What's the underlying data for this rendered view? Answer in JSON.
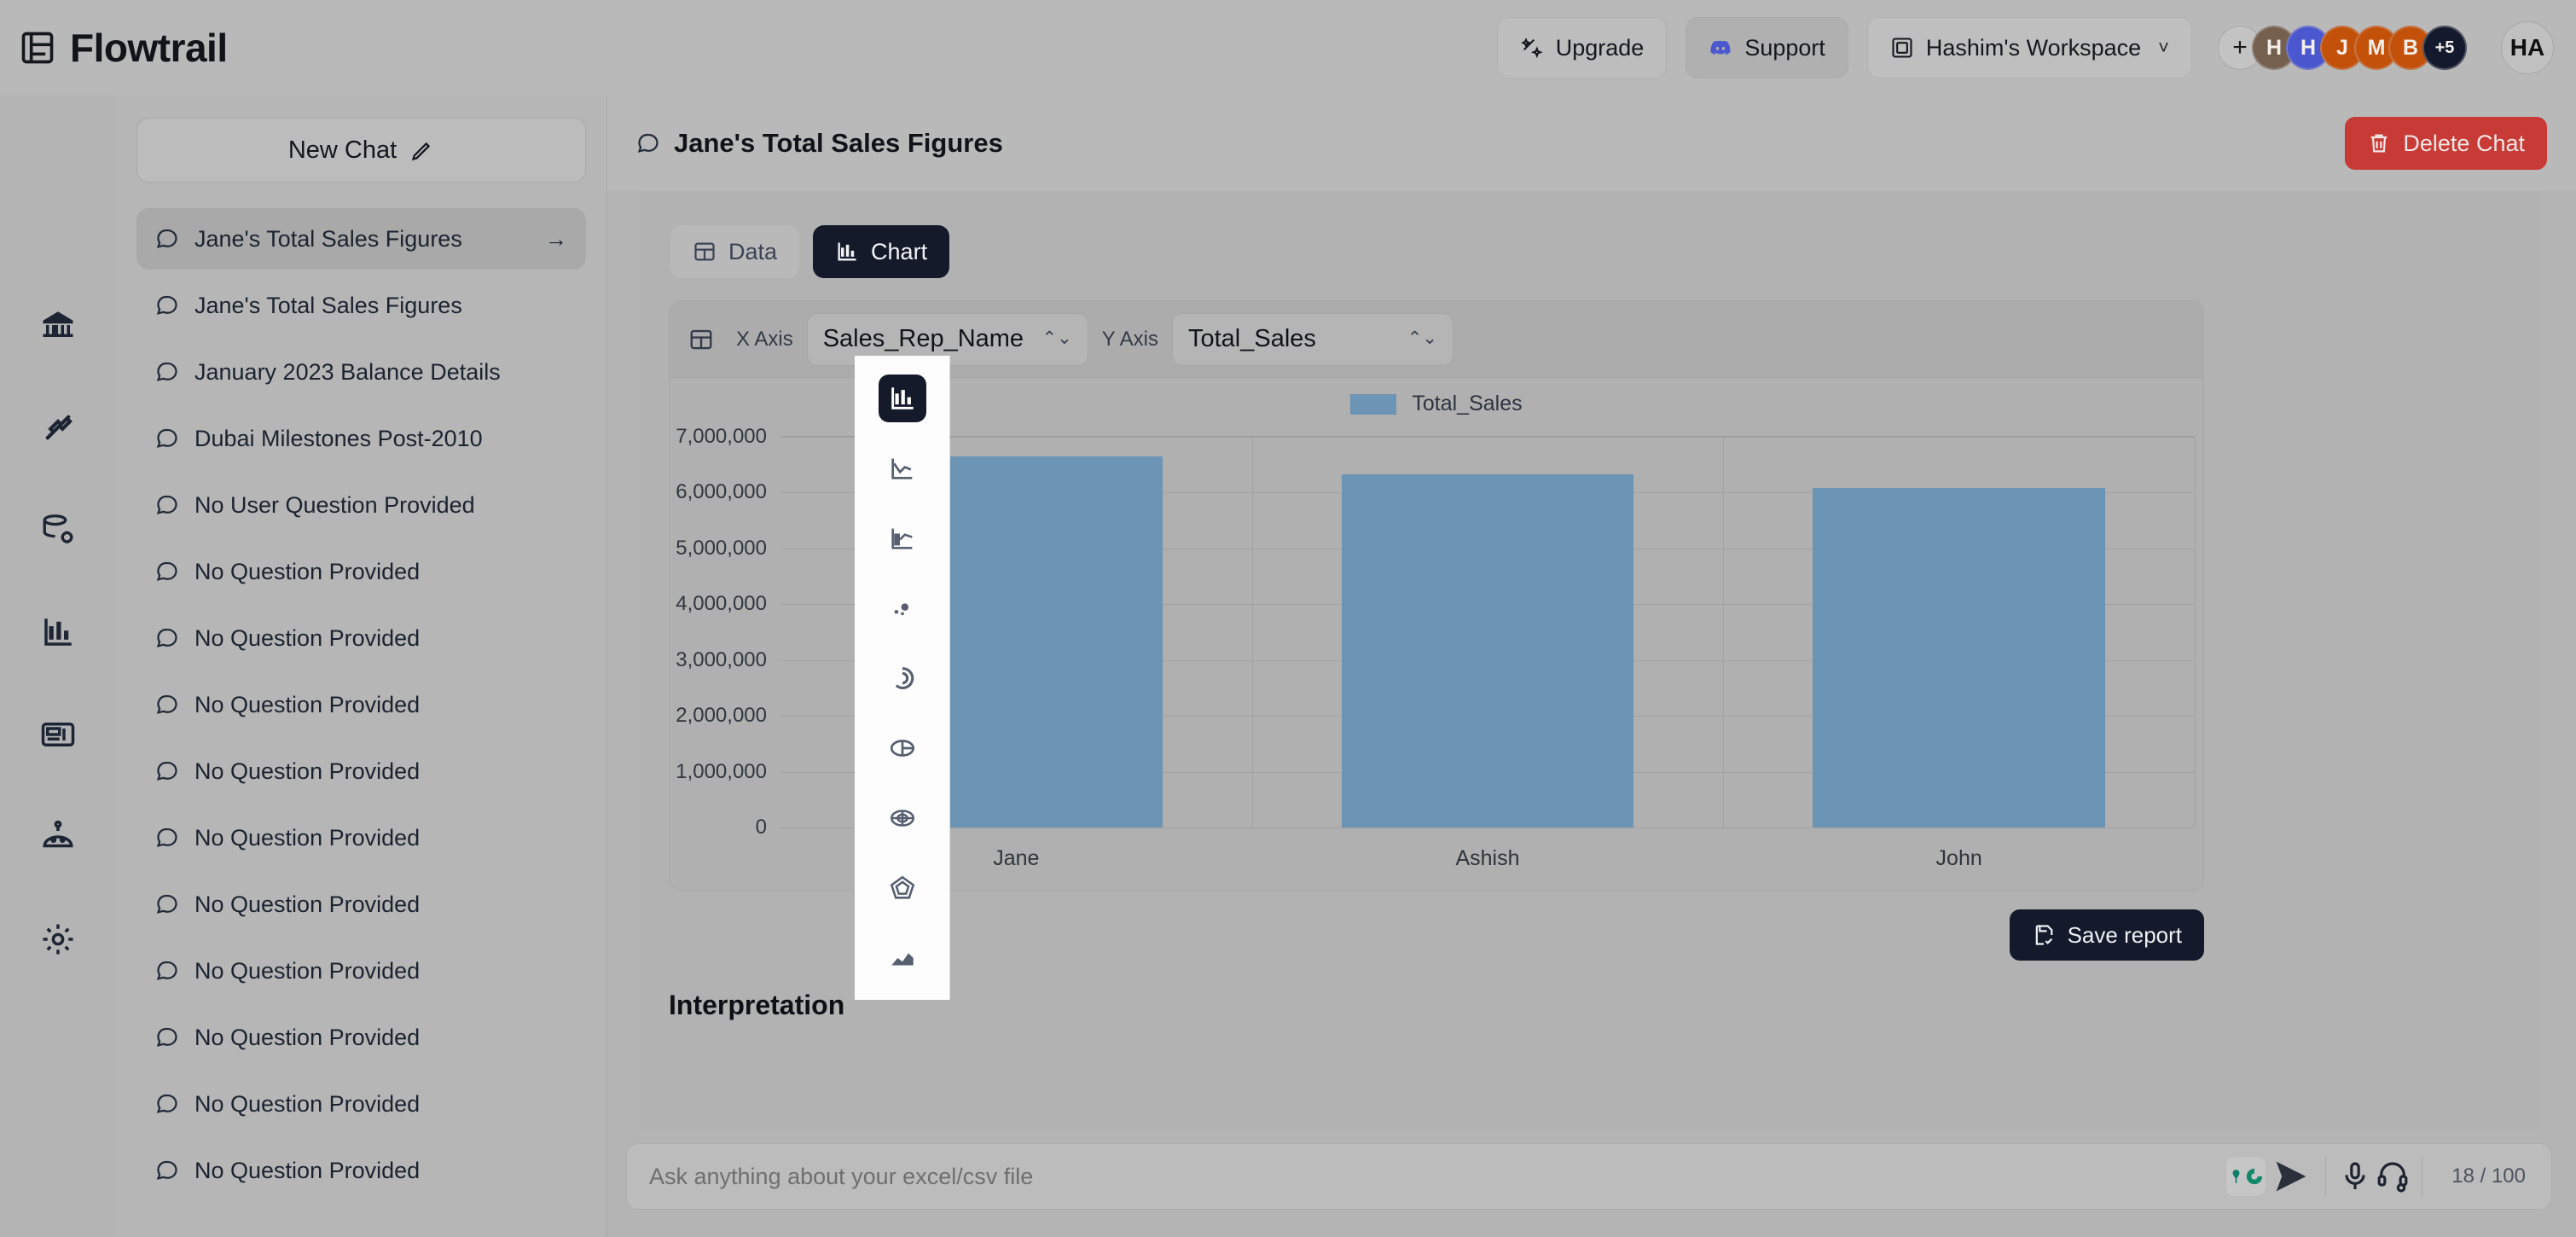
{
  "brand": {
    "name": "Flowtrail",
    "logo_icon": "grid-logo-icon"
  },
  "header": {
    "upgrade_label": "Upgrade",
    "upgrade_icon": "sparkle-icon",
    "support_label": "Support",
    "support_icon": "discord-icon",
    "workspace_label": "Hashim's Workspace",
    "workspace_icon": "workspace-icon",
    "workspace_chevron": "˅",
    "add_member_label": "+",
    "avatars": [
      {
        "initial": "H",
        "color": "#75604f"
      },
      {
        "initial": "H",
        "color": "#4a57cf"
      },
      {
        "initial": "J",
        "color": "#c4510a"
      },
      {
        "initial": "M",
        "color": "#c4510a"
      },
      {
        "initial": "B",
        "color": "#c4510a"
      },
      {
        "initial": "+5",
        "color": "#141a2e"
      }
    ],
    "self_avatar": "HA"
  },
  "rail": {
    "items": [
      {
        "name": "home",
        "icon": "bank-home-icon"
      },
      {
        "name": "connections",
        "icon": "plug-connect-icon"
      },
      {
        "name": "datasources",
        "icon": "database-settings-icon"
      },
      {
        "name": "charts",
        "icon": "bar-chart-icon"
      },
      {
        "name": "dashboards",
        "icon": "dashboard-icon"
      },
      {
        "name": "assistant",
        "icon": "robot-icon"
      },
      {
        "name": "settings",
        "icon": "gear-icon"
      }
    ]
  },
  "sidebar": {
    "new_chat_label": "New Chat",
    "new_chat_icon": "pencil-icon",
    "active_arrow": "→",
    "chats": [
      "Jane's Total Sales Figures",
      "Jane's Total Sales Figures",
      "January 2023 Balance Details",
      "Dubai Milestones Post-2010",
      "No User Question Provided",
      "No Question Provided",
      "No Question Provided",
      "No Question Provided",
      "No Question Provided",
      "No Question Provided",
      "No Question Provided",
      "No Question Provided",
      "No Question Provided",
      "No Question Provided",
      "No Question Provided"
    ]
  },
  "main": {
    "title": "Jane's Total Sales Figures",
    "title_icon": "chat-bubble-icon",
    "delete_label": "Delete Chat",
    "delete_icon": "trash-icon",
    "delete_color": "#c73a36",
    "tabs": [
      {
        "label": "Data",
        "icon": "table-icon",
        "active": false
      },
      {
        "label": "Chart",
        "icon": "bar-chart-icon",
        "active": true
      }
    ],
    "axis_controls": {
      "grid_icon": "table-icon",
      "x_label": "X Axis",
      "x_value": "Sales_Rep_Name",
      "y_label": "Y Axis",
      "y_value": "Total_Sales",
      "stepper_glyph": "⌃⌄"
    },
    "save_report_label": "Save report",
    "save_report_icon": "save-check-icon",
    "interpretation_heading": "Interpretation"
  },
  "chart_type_picker": {
    "options": [
      {
        "name": "bar",
        "icon": "bar-chart-icon",
        "selected": true
      },
      {
        "name": "line",
        "icon": "line-chart-icon",
        "selected": false
      },
      {
        "name": "combo",
        "icon": "combo-chart-icon",
        "selected": false
      },
      {
        "name": "scatter",
        "icon": "scatter-chart-icon",
        "selected": false
      },
      {
        "name": "donut",
        "icon": "donut-chart-icon",
        "selected": false
      },
      {
        "name": "pie",
        "icon": "pie-chart-icon",
        "selected": false
      },
      {
        "name": "polar",
        "icon": "polar-chart-icon",
        "selected": false
      },
      {
        "name": "radar",
        "icon": "radar-chart-icon",
        "selected": false
      },
      {
        "name": "area",
        "icon": "area-chart-icon",
        "selected": false
      }
    ]
  },
  "chart_data": {
    "type": "bar",
    "title": "",
    "categories": [
      "Jane",
      "Ashish",
      "John"
    ],
    "series": [
      {
        "name": "Total_Sales",
        "values": [
          6650000,
          6330000,
          6080000
        ],
        "color": "#6c94b4"
      }
    ],
    "xlabel": "",
    "ylabel": "",
    "ylim": [
      0,
      7000000
    ],
    "yticks": [
      0,
      1000000,
      2000000,
      3000000,
      4000000,
      5000000,
      6000000,
      7000000
    ],
    "ytick_labels": [
      "0",
      "1,000,000",
      "2,000,000",
      "3,000,000",
      "4,000,000",
      "5,000,000",
      "6,000,000",
      "7,000,000"
    ],
    "grid": true,
    "legend": "top"
  },
  "composer": {
    "placeholder": "Ask anything about your excel/csv file",
    "value": "",
    "grammarly_icon": "grammarly-icon",
    "send_icon": "send-icon",
    "mic_icon": "microphone-icon",
    "voice_icon": "headset-settings-icon",
    "counter": "18 / 100"
  }
}
